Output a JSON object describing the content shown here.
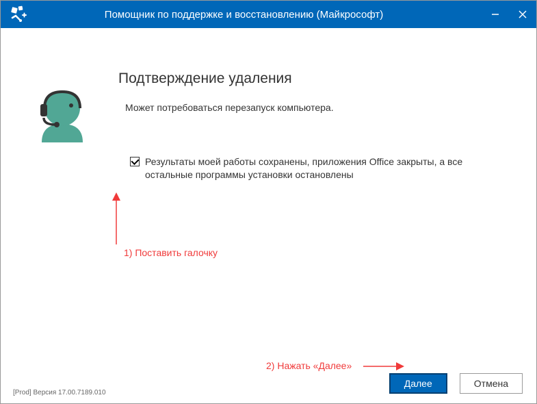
{
  "titlebar": {
    "title": "Помощник по поддержке и восстановлению (Майкрософт)"
  },
  "main": {
    "heading": "Подтверждение удаления",
    "subtext": "Может потребоваться перезапуск компьютера.",
    "checkbox_label": "Результаты моей работы сохранены, приложения Office закрыты, а все остальные программы установки остановлены"
  },
  "annotations": {
    "step1": "1) Поставить галочку",
    "step2": "2) Нажать «Далее»"
  },
  "footer": {
    "version": "[Prod] Версия 17.00.7189.010",
    "next_label": "Далее",
    "cancel_label": "Отмена"
  }
}
